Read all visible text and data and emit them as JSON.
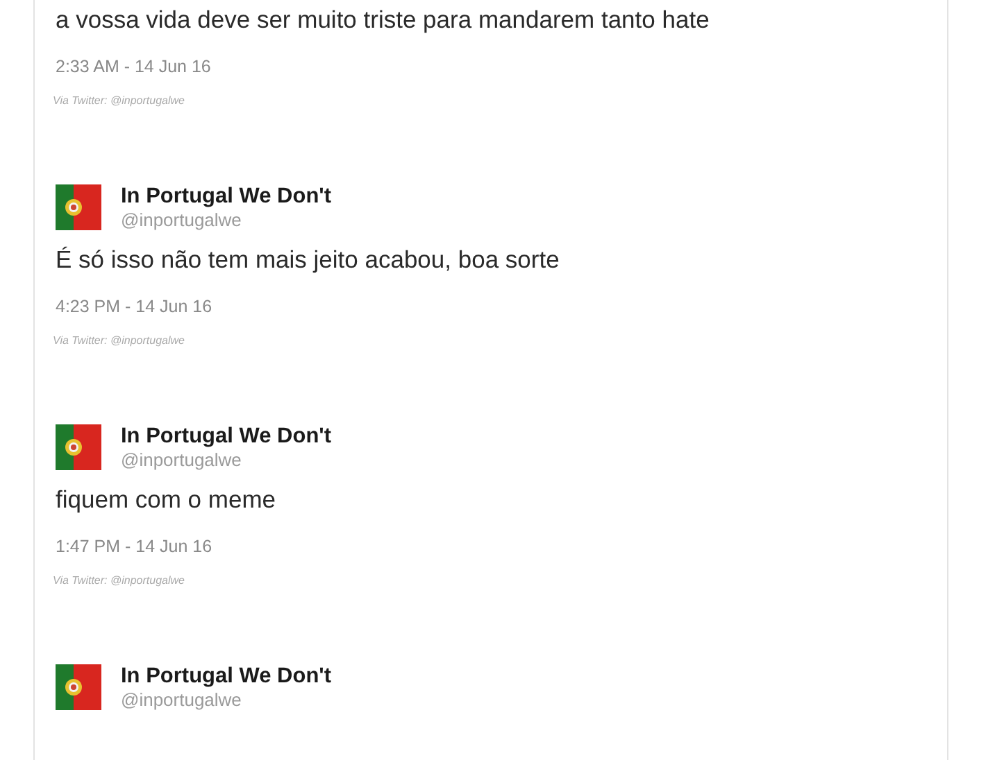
{
  "tweets": [
    {
      "text": "a vossa vida deve ser muito triste para mandarem tanto hate",
      "time": "2:33 AM - 14 Jun 16",
      "via": "Via Twitter: @inportugalwe"
    },
    {
      "name": "In Portugal We Don't",
      "handle": "@inportugalwe",
      "text": "É só isso não tem mais jeito acabou, boa sorte",
      "time": "4:23 PM - 14 Jun 16",
      "via": "Via Twitter: @inportugalwe"
    },
    {
      "name": "In Portugal We Don't",
      "handle": "@inportugalwe",
      "text": "fiquem com o meme",
      "time": "1:47 PM - 14 Jun 16",
      "via": "Via Twitter: @inportugalwe"
    },
    {
      "name": "In Portugal We Don't",
      "handle": "@inportugalwe"
    }
  ]
}
